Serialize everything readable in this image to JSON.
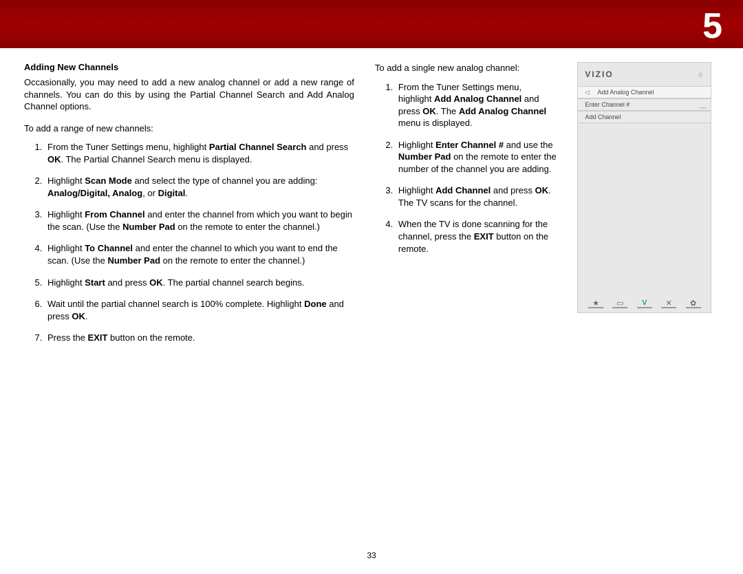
{
  "chapter": "5",
  "page_number": "33",
  "left": {
    "heading": "Adding New Channels",
    "intro": "Occasionally, you may need to add a new analog channel or add a new range of channels. You can do this by using the Partial Channel Search and Add Analog Channel options.",
    "lead": "To add a range of new channels:",
    "steps": {
      "s1a": "From the Tuner Settings menu, highlight ",
      "s1b": "Partial Channel Search",
      "s1c": " and press ",
      "s1d": "OK",
      "s1e": ". The Partial Channel Search menu is displayed.",
      "s2a": "Highlight ",
      "s2b": "Scan Mode",
      "s2c": " and select the type of channel you are adding: ",
      "s2d": "Analog/Digital, Analog",
      "s2e": ", or ",
      "s2f": "Digital",
      "s2g": ".",
      "s3a": "Highlight ",
      "s3b": "From Channel",
      "s3c": " and enter the channel from which you want to begin the scan. (Use the ",
      "s3d": "Number Pad",
      "s3e": " on the remote to enter the channel.)",
      "s4a": "Highlight ",
      "s4b": "To Channel",
      "s4c": " and enter the channel to which you want to end the scan. (Use the ",
      "s4d": "Number Pad",
      "s4e": " on the remote to enter the channel.)",
      "s5a": "Highlight ",
      "s5b": "Start",
      "s5c": " and press ",
      "s5d": "OK",
      "s5e": ". The partial channel search begins.",
      "s6a": "Wait until the partial channel search is 100% complete. Highlight ",
      "s6b": "Done",
      "s6c": " and press ",
      "s6d": "OK",
      "s6e": ".",
      "s7a": "Press the ",
      "s7b": "EXIT",
      "s7c": " button on the remote."
    }
  },
  "right": {
    "lead": "To add a single new analog channel:",
    "steps": {
      "s1a": "From the Tuner Settings menu, highlight ",
      "s1b": "Add Analog Channel",
      "s1c": " and press ",
      "s1d": "OK",
      "s1e": ". The ",
      "s1f": "Add Analog Channel",
      "s1g": " menu is displayed.",
      "s2a": "Highlight ",
      "s2b": "Enter Channel #",
      "s2c": " and use the ",
      "s2d": "Number Pad",
      "s2e": " on the remote to enter the number of the channel you are adding.",
      "s3a": "Highlight ",
      "s3b": "Add Channel",
      "s3c": " and press ",
      "s3d": "OK",
      "s3e": ". The TV scans for the channel.",
      "s4a": "When the TV is done scanning for the channel, press the ",
      "s4b": "EXIT",
      "s4c": " button on the remote."
    }
  },
  "ui": {
    "brand": "VIZIO",
    "rows": {
      "r1": "Add Analog Channel",
      "r2_label": "Enter Channel #",
      "r2_value": "__",
      "r3": "Add Channel"
    },
    "footer_icons": {
      "star": "★",
      "rect": "▭",
      "v": "V",
      "x": "✕",
      "gear": "✿"
    }
  }
}
